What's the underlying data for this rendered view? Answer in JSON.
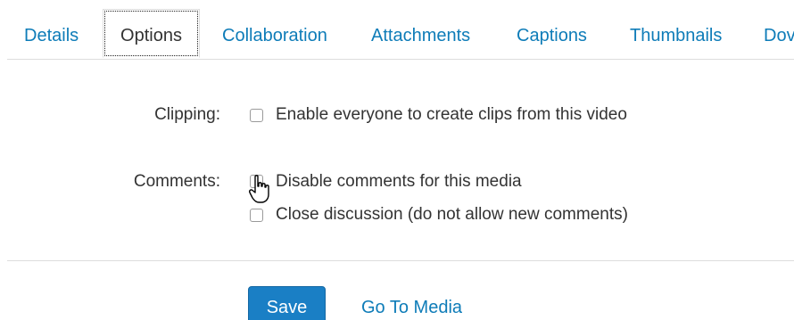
{
  "tabs": [
    {
      "label": "Details",
      "active": false
    },
    {
      "label": "Options",
      "active": true
    },
    {
      "label": "Collaboration",
      "active": false
    },
    {
      "label": "Attachments",
      "active": false
    },
    {
      "label": "Captions",
      "active": false
    },
    {
      "label": "Thumbnails",
      "active": false
    },
    {
      "label": "Dov",
      "active": false
    }
  ],
  "clipping": {
    "label": "Clipping:",
    "option": {
      "label": "Enable everyone to create clips from this video",
      "checked": false
    }
  },
  "comments": {
    "label": "Comments:",
    "options": [
      {
        "label": "Disable comments for this media",
        "checked": false
      },
      {
        "label": "Close discussion (do not allow new comments)",
        "checked": false
      }
    ]
  },
  "actions": {
    "save_label": "Save",
    "goto_label": "Go To Media"
  },
  "colors": {
    "link": "#0e7cb8",
    "primary_button": "#1a7fc5"
  },
  "cursor": "hand-pointer-icon"
}
